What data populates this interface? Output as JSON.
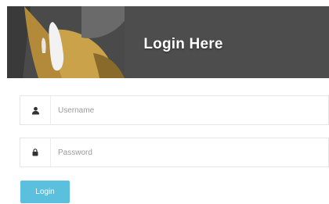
{
  "header": {
    "title": "Login Here"
  },
  "form": {
    "username": {
      "icon": "user-icon",
      "placeholder": "Username",
      "value": ""
    },
    "password": {
      "icon": "lock-icon",
      "placeholder": "Password",
      "value": ""
    },
    "submit_label": "Login"
  },
  "colors": {
    "header_bg": "#4d4d4d",
    "accent": "#5bc0de",
    "field_border": "#e6e6e6"
  }
}
